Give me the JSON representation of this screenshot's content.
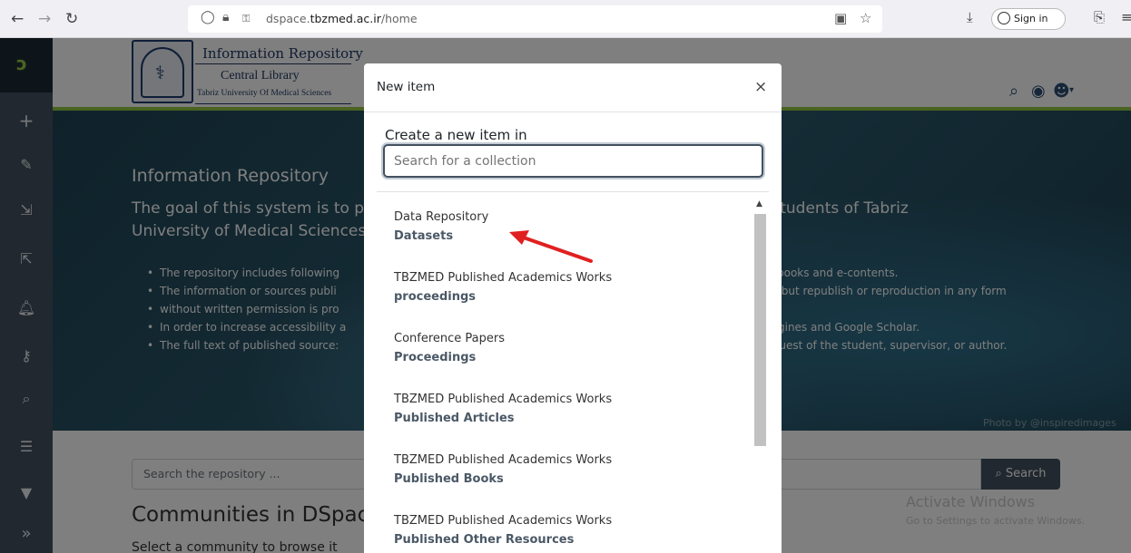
{
  "browser": {
    "url_prefix": "dspace.",
    "url_domain": "tbzmed.ac.ir",
    "url_path": "/home",
    "sign_in_label": "Sign in"
  },
  "header": {
    "logo_line1": "Information Repository",
    "logo_line2": "Central Library",
    "logo_line3": "Tabriz University Of Medical Sciences"
  },
  "banner": {
    "title": "Information Repository",
    "description": "The goal of this system is to pu s, staff, and students of Tabriz University of Medical Sciences:",
    "desc_left_1": "The goal of this system is to pu",
    "desc_right_1": "s, staff, and students of Tabriz",
    "desc_left_2": "University of Medical Sciences:",
    "bullets": [
      {
        "left": "The repository includes following",
        "right": "s, books and e-contents."
      },
      {
        "left": "The information or sources publi",
        "right": "e, but republish or reproduction in any form"
      },
      {
        "left": "without written permission is pro",
        "right": ""
      },
      {
        "left": "In order to increase accessibility a",
        "right": "ngines and Google Scholar."
      },
      {
        "left": "The full text of published source:",
        "right": "equest of the student, supervisor, or author."
      }
    ],
    "photo_credit": "Photo by @inspiredimages"
  },
  "search": {
    "placeholder": "Search the repository ...",
    "button_label": "Search"
  },
  "communities": {
    "title": "Communities in DSpac",
    "subtitle": "Select a community to browse it"
  },
  "windows": {
    "activate_title": "Activate Windows",
    "activate_sub": "Go to Settings to activate Windows."
  },
  "modal": {
    "title": "New item",
    "close_symbol": "×",
    "label": "Create a new item in",
    "search_placeholder": "Search for a collection",
    "items": [
      {
        "parent": "Data Repository",
        "name": "Datasets"
      },
      {
        "parent": "TBZMED Published Academics Works",
        "name": "proceedings"
      },
      {
        "parent": "Conference Papers",
        "name": "Proceedings"
      },
      {
        "parent": "TBZMED Published Academics Works",
        "name": "Published Articles"
      },
      {
        "parent": "TBZMED Published Academics Works",
        "name": "Published Books"
      },
      {
        "parent": "TBZMED Published Academics Works",
        "name": "Published Other Resources"
      }
    ]
  },
  "colors": {
    "sidebar": "#43515f",
    "accent_green": "#92c642",
    "annotation_arrow": "#e02020"
  }
}
